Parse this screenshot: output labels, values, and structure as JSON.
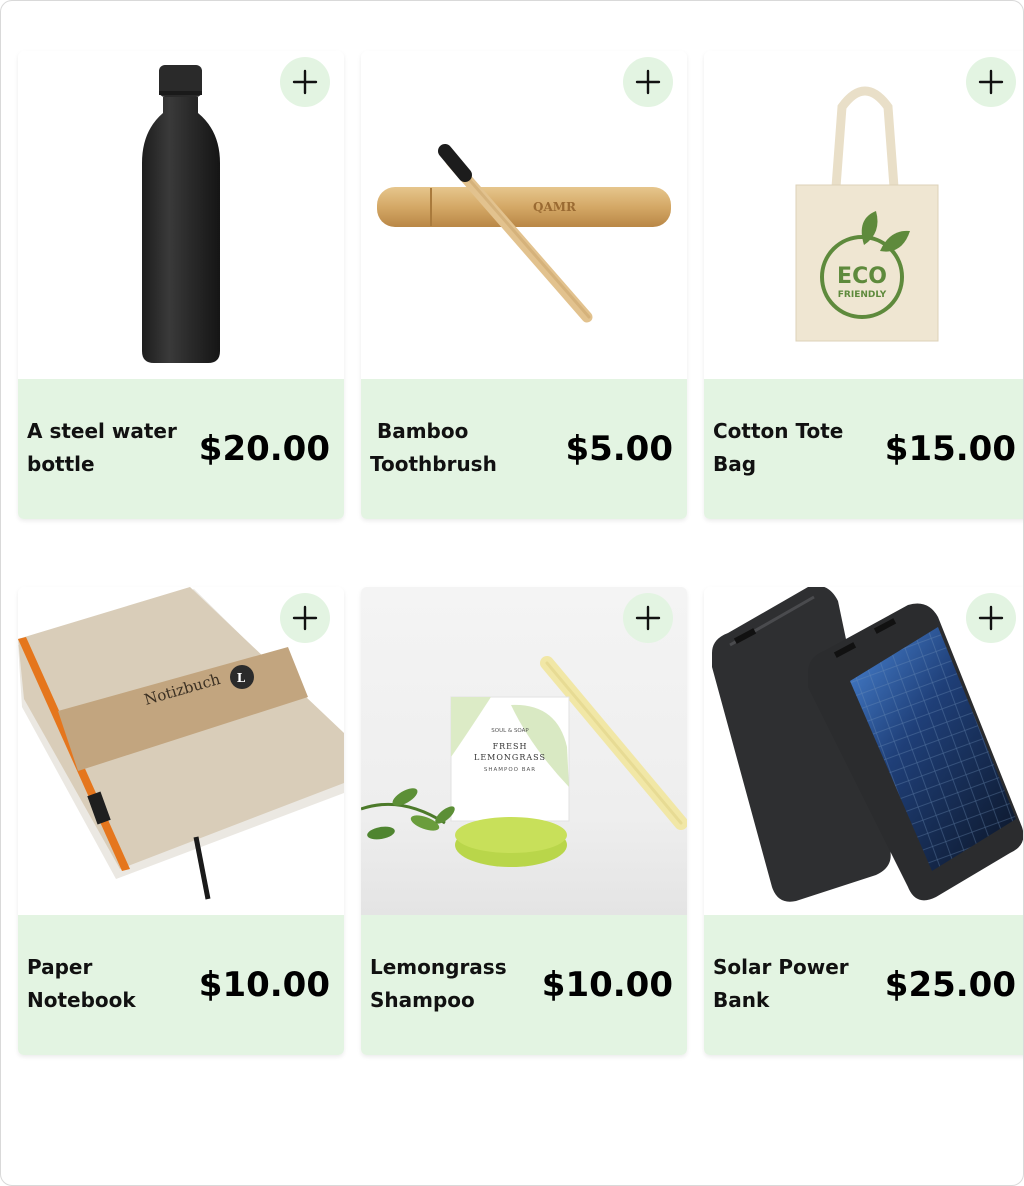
{
  "products": [
    {
      "name": "A steel water bottle",
      "price": "$20.00",
      "image": "black steel water bottle"
    },
    {
      "name": " Bamboo Toothbrush",
      "price": "$5.00",
      "image": "bamboo toothbrush with case"
    },
    {
      "name": "Cotton Tote Bag",
      "price": "$15.00",
      "image": "eco friendly tote bag",
      "image_text": [
        "ECO",
        "FRIENDLY"
      ]
    },
    {
      "name": "Paper Notebook",
      "price": "$10.00",
      "image": "kraft paper notebook",
      "image_text": [
        "Notizbuch",
        "L"
      ]
    },
    {
      "name": "Lemongrass Shampoo",
      "price": "$10.00",
      "image": "lemongrass shampoo bar",
      "image_text": [
        "SOUL & SOAP",
        "FRESH",
        "LEMONGRASS",
        "SHAMPOO BAR"
      ]
    },
    {
      "name": "Solar Power Bank",
      "price": "$25.00",
      "image": "solar power bank pair"
    }
  ],
  "add_button": {
    "icon": "plus-icon",
    "aria_label": "Add to cart"
  },
  "colors": {
    "card_info_bg": "#e3f4e2",
    "add_button_bg": "#e3f4e2",
    "price_text": "#000000",
    "name_text": "#111111"
  }
}
